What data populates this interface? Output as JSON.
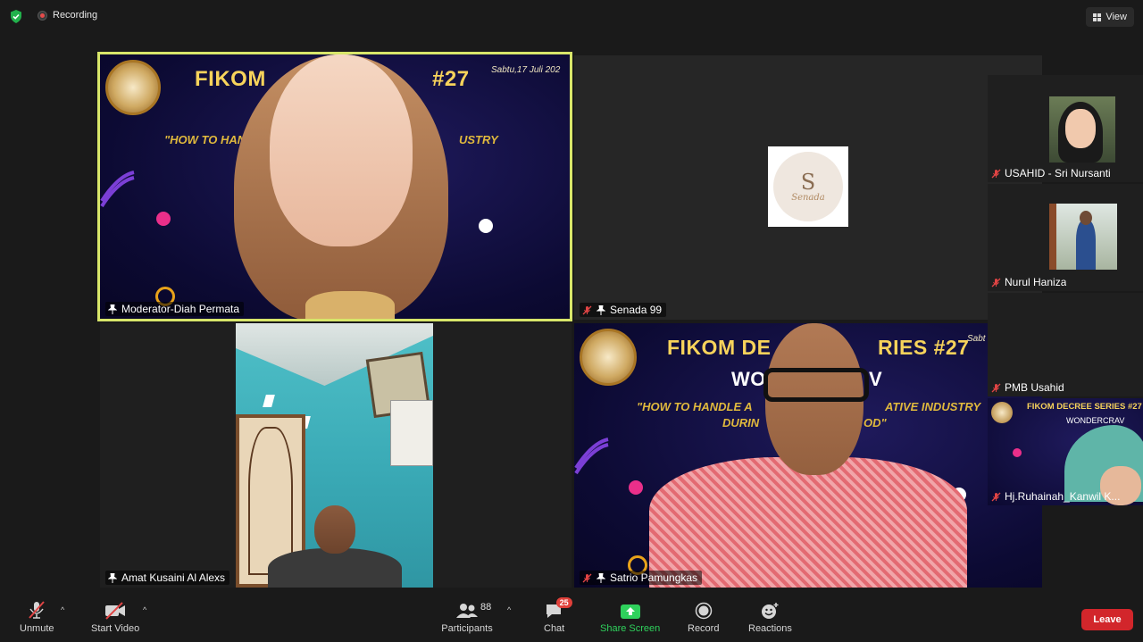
{
  "topbar": {
    "recording_label": "Recording",
    "view_label": "View"
  },
  "tiles": [
    {
      "name": "Moderator-Diah Permata",
      "muted": false
    },
    {
      "name": "Senada 99",
      "muted": true
    },
    {
      "name": "Amat Kusaini Al Alexs",
      "muted": false
    },
    {
      "name": "Satrio Pamungkas",
      "muted": true
    }
  ],
  "slide": {
    "title_fragment": "FIKOM",
    "series_number": "#27",
    "date": "Sabtu,17 Juli 202",
    "subtitle_left": "\"HOW TO HAN",
    "subtitle_right": "USTRY",
    "t4_title": "FIKOM DE",
    "t4_title_right": "RIES #27",
    "t4_title_small": "Sabt",
    "t4_sub_1": "WO",
    "t4_sub_1_right": "V",
    "t4_line1_left": "\"HOW TO HANDLE A",
    "t4_line1_right": "ATIVE INDUSTRY",
    "t4_line2_left": "DURIN",
    "t4_line2_right": "OD\""
  },
  "senada_logo": {
    "mark": "S",
    "text": "Senada"
  },
  "sidebar": [
    {
      "name": "USAHID - Sri Nursanti"
    },
    {
      "name": "Nurul Haniza"
    },
    {
      "name": "PMB Usahid"
    },
    {
      "name": "Hj.Ruhainah_Kanwil K...",
      "slide_title": "FIKOM DECREE SERIES #27",
      "slide_sub": "WONDERCRAV"
    }
  ],
  "toolbar": {
    "unmute": "Unmute",
    "start_video": "Start Video",
    "participants": "Participants",
    "participants_count": "88",
    "chat": "Chat",
    "chat_badge": "25",
    "share_screen": "Share Screen",
    "record": "Record",
    "reactions": "Reactions",
    "leave": "Leave"
  },
  "colors": {
    "active_speaker_border": "#d8e66a",
    "share_green": "#2fd15c",
    "leave_red": "#d2262b",
    "slide_gold": "#f7d35b"
  }
}
